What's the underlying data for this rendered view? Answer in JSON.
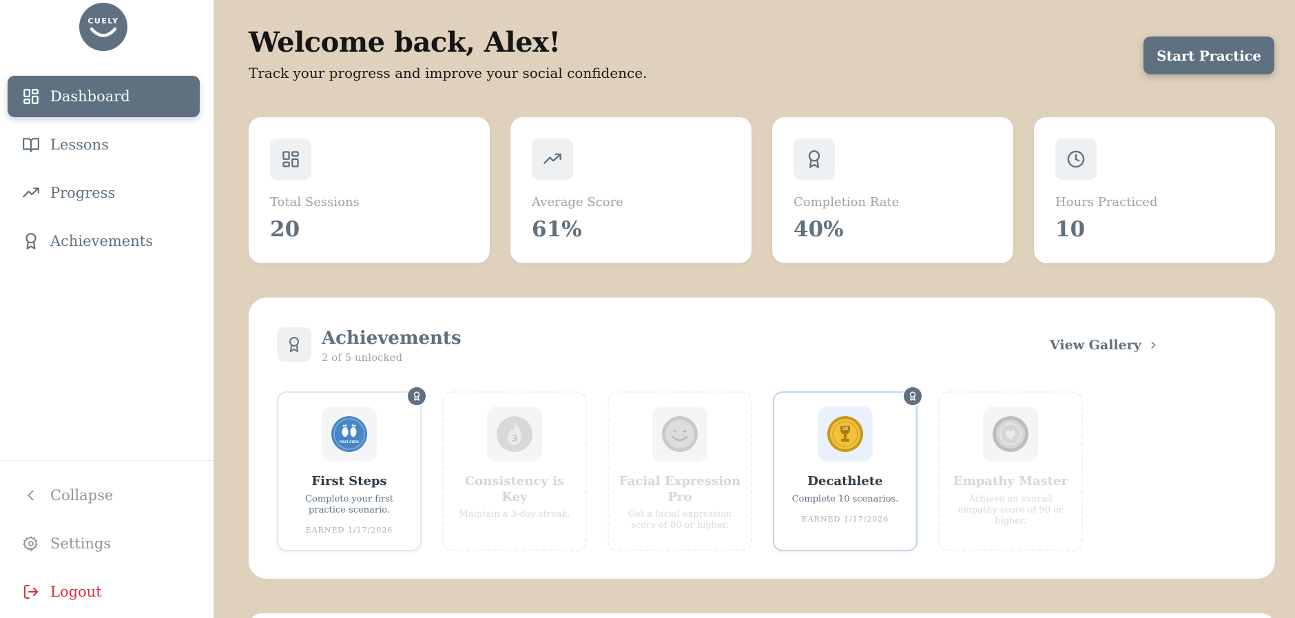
{
  "app": {
    "logo_text": "CUELY",
    "accent": "#5f7180",
    "background": "#e0d1bc",
    "danger": "#dc2d3b"
  },
  "sidebar": {
    "items": [
      {
        "label": "Dashboard",
        "icon": "dashboard-grid-icon",
        "active": true
      },
      {
        "label": "Lessons",
        "icon": "book-open-icon",
        "active": false
      },
      {
        "label": "Progress",
        "icon": "trending-up-icon",
        "active": false
      },
      {
        "label": "Achievements",
        "icon": "award-ribbon-icon",
        "active": false
      }
    ],
    "bottom": {
      "collapse": "Collapse",
      "settings": "Settings",
      "logout": "Logout"
    }
  },
  "header": {
    "title": "Welcome back, Alex!",
    "subtitle": "Track your progress and improve your social confidence.",
    "start_button": "Start Practice"
  },
  "stats": [
    {
      "label": "Total Sessions",
      "value": "20",
      "icon": "dashboard-grid-icon"
    },
    {
      "label": "Average Score",
      "value": "61%",
      "icon": "trending-up-icon"
    },
    {
      "label": "Completion Rate",
      "value": "40%",
      "icon": "award-ribbon-icon"
    },
    {
      "label": "Hours Practiced",
      "value": "10",
      "icon": "clock-icon"
    }
  ],
  "achievements": {
    "title": "Achievements",
    "subtitle": "2 of 5 unlocked",
    "view_gallery": "View Gallery",
    "badges": [
      {
        "name": "First Steps",
        "desc": "Complete your first practice scenario.",
        "earned": "EARNED 1/17/2026",
        "badge_text": "FIRST STEPS",
        "state": "earned"
      },
      {
        "name": "Consistency is Key",
        "desc": "Maintain a 3-day streak.",
        "earned": "",
        "state": "locked"
      },
      {
        "name": "Facial Expression Pro",
        "desc": "Get a facial expression score of 80 or higher.",
        "earned": "",
        "state": "locked"
      },
      {
        "name": "Decathlete",
        "desc": "Complete 10 scenarios.",
        "earned": "EARNED 1/17/2026",
        "badge_text": "10",
        "state": "earned"
      },
      {
        "name": "Empathy Master",
        "desc": "Achieve an overall empathy score of 90 or higher.",
        "earned": "",
        "state": "locked"
      }
    ]
  }
}
